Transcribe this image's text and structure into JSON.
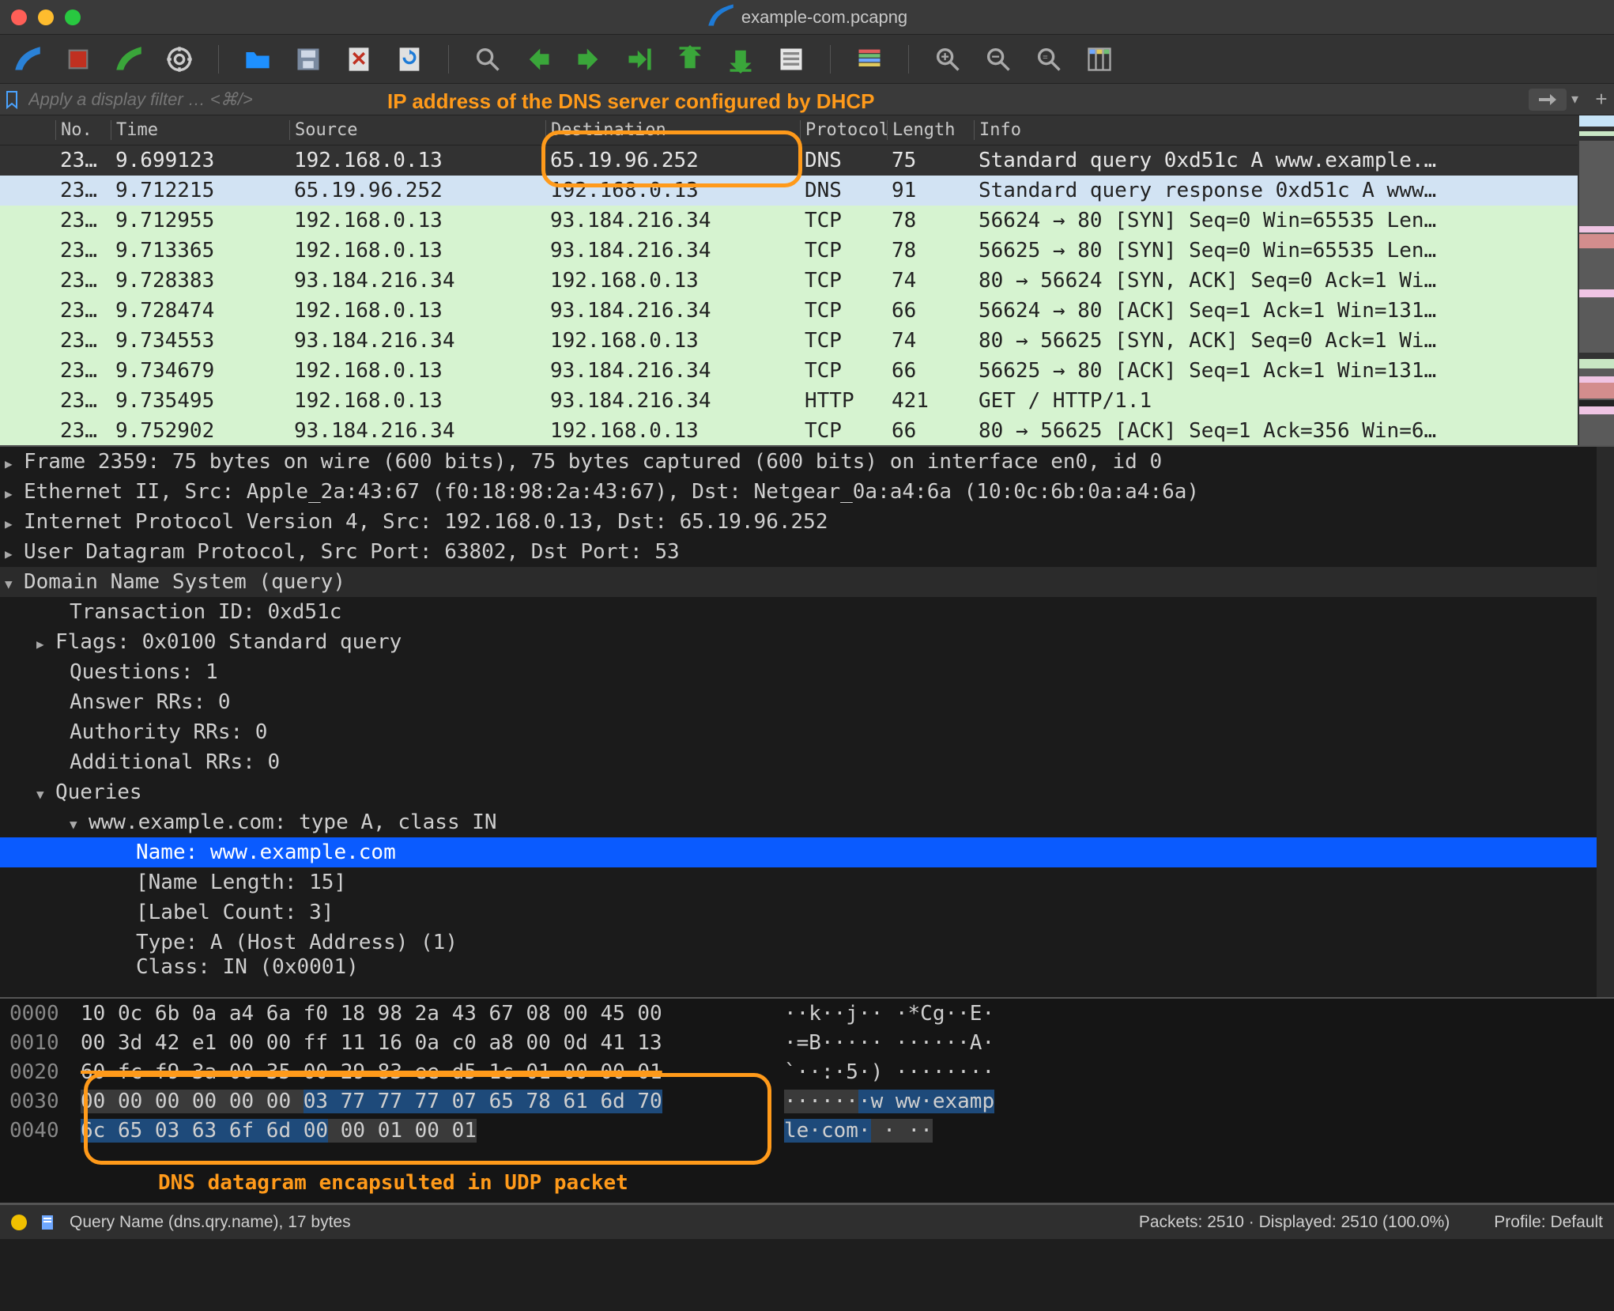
{
  "window": {
    "title": "example-com.pcapng"
  },
  "filter": {
    "placeholder": "Apply a display filter … <⌘/>"
  },
  "annotations": {
    "dns_server_ip": "IP address of the DNS server configured by DHCP",
    "dns_udp_encap": "DNS datagram encapsulted in UDP packet"
  },
  "columns": [
    "No.",
    "Time",
    "Source",
    "Destination",
    "Protocol",
    "Length",
    "Info"
  ],
  "rows": [
    {
      "class": "selected",
      "no": "23…",
      "time": "9.699123",
      "src": "192.168.0.13",
      "dst": "65.19.96.252",
      "proto": "DNS",
      "len": "75",
      "info": "Standard query 0xd51c A www.example.…"
    },
    {
      "class": "resp",
      "no": "23…",
      "time": "9.712215",
      "src": "65.19.96.252",
      "dst": "192.168.0.13",
      "proto": "DNS",
      "len": "91",
      "info": "Standard query response 0xd51c A www…"
    },
    {
      "class": "tcp",
      "no": "23…",
      "time": "9.712955",
      "src": "192.168.0.13",
      "dst": "93.184.216.34",
      "proto": "TCP",
      "len": "78",
      "info": "56624 → 80 [SYN] Seq=0 Win=65535 Len…"
    },
    {
      "class": "tcp",
      "no": "23…",
      "time": "9.713365",
      "src": "192.168.0.13",
      "dst": "93.184.216.34",
      "proto": "TCP",
      "len": "78",
      "info": "56625 → 80 [SYN] Seq=0 Win=65535 Len…"
    },
    {
      "class": "tcp",
      "no": "23…",
      "time": "9.728383",
      "src": "93.184.216.34",
      "dst": "192.168.0.13",
      "proto": "TCP",
      "len": "74",
      "info": "80 → 56624 [SYN, ACK] Seq=0 Ack=1 Wi…"
    },
    {
      "class": "tcp",
      "no": "23…",
      "time": "9.728474",
      "src": "192.168.0.13",
      "dst": "93.184.216.34",
      "proto": "TCP",
      "len": "66",
      "info": "56624 → 80 [ACK] Seq=1 Ack=1 Win=131…"
    },
    {
      "class": "tcp",
      "no": "23…",
      "time": "9.734553",
      "src": "93.184.216.34",
      "dst": "192.168.0.13",
      "proto": "TCP",
      "len": "74",
      "info": "80 → 56625 [SYN, ACK] Seq=0 Ack=1 Wi…"
    },
    {
      "class": "tcp",
      "no": "23…",
      "time": "9.734679",
      "src": "192.168.0.13",
      "dst": "93.184.216.34",
      "proto": "TCP",
      "len": "66",
      "info": "56625 → 80 [ACK] Seq=1 Ack=1 Win=131…"
    },
    {
      "class": "http",
      "no": "23…",
      "time": "9.735495",
      "src": "192.168.0.13",
      "dst": "93.184.216.34",
      "proto": "HTTP",
      "len": "421",
      "info": "GET / HTTP/1.1"
    },
    {
      "class": "tcp",
      "no": "23…",
      "time": "9.752902",
      "src": "93.184.216.34",
      "dst": "192.168.0.13",
      "proto": "TCP",
      "len": "66",
      "info": "80 → 56625 [ACK] Seq=1 Ack=356 Win=6…"
    }
  ],
  "details": {
    "frame": "Frame 2359: 75 bytes on wire (600 bits), 75 bytes captured (600 bits) on interface en0, id 0",
    "eth": "Ethernet II, Src: Apple_2a:43:67 (f0:18:98:2a:43:67), Dst: Netgear_0a:a4:6a (10:0c:6b:0a:a4:6a)",
    "ip": "Internet Protocol Version 4, Src: 192.168.0.13, Dst: 65.19.96.252",
    "udp": "User Datagram Protocol, Src Port: 63802, Dst Port: 53",
    "dns_head": "Domain Name System (query)",
    "txid": "Transaction ID: 0xd51c",
    "flags": "Flags: 0x0100 Standard query",
    "questions": "Questions: 1",
    "answers": "Answer RRs: 0",
    "authority": "Authority RRs: 0",
    "additional": "Additional RRs: 0",
    "queries_head": "Queries",
    "query_item": "www.example.com: type A, class IN",
    "name": "Name: www.example.com",
    "name_len": "[Name Length: 15]",
    "label_count": "[Label Count: 3]",
    "type": "Type: A (Host Address) (1)",
    "class_trunc": "Class: IN (0x0001)"
  },
  "hex": {
    "r0": {
      "off": "0000",
      "b": "10 0c 6b 0a a4 6a f0 18  98 2a 43 67 08 00 45 00",
      "a": "··k··j·· ·*Cg··E·"
    },
    "r1": {
      "off": "0010",
      "b": "00 3d 42 e1 00 00 ff 11  16 0a c0 a8 00 0d 41 13",
      "a": "·=B····· ······A·"
    },
    "r2": {
      "off": "0020",
      "b": "60 fc f9 3a 00 35 00 29  83 ee d5 1c 01 00 00 01",
      "a": "`··:·5·) ········"
    },
    "r3": {
      "off": "0030",
      "b1": "00 00 00 00 00 00 ",
      "b2": "03 77  77 77 07 65 78 61 6d 70",
      "a1": "······",
      "a2": "·w ww·examp"
    },
    "r4": {
      "off": "0040",
      "b1": "6c 65 03 63 6f 6d 00",
      "b2": " 00  01 00 01",
      "a1": "le·com·",
      "a2": " · ··"
    }
  },
  "status": {
    "left": "Query Name (dns.qry.name), 17 bytes",
    "mid": "Packets: 2510 · Displayed: 2510 (100.0%)",
    "right": "Profile: Default"
  }
}
